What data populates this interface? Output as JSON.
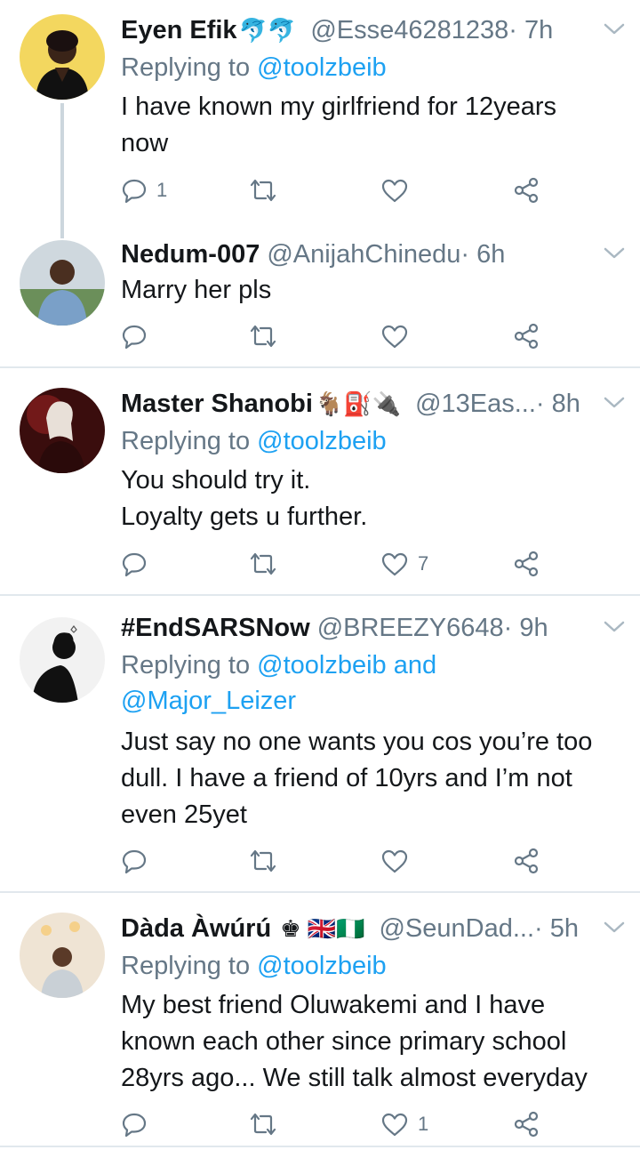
{
  "colors": {
    "link": "#1da1f2",
    "secondary_text": "#657786",
    "primary_text": "#14171a",
    "divider": "#e1e8ed",
    "thread_line": "#ccd6dd"
  },
  "tweets": [
    {
      "name": "Eyen Efik",
      "name_emoji": "🐬🐬",
      "handle": "@Esse46281238",
      "time": " · 7h",
      "replying_prefix": "Replying to ",
      "replying_to": "@toolzbeib",
      "text": "I have known my girlfriend for 12years\nnow",
      "reply_count": "1",
      "like_count": ""
    },
    {
      "name": "Nedum-007",
      "name_emoji": "",
      "handle": "@AnijahChinedu",
      "time": " · 6h",
      "text": "Marry her pls",
      "reply_count": "",
      "like_count": ""
    },
    {
      "name": "Master Shanobi",
      "name_emoji": "🐐⛽🔌",
      "handle": "@13Eas...",
      "time": " · 8h",
      "replying_prefix": "Replying to ",
      "replying_to": "@toolzbeib",
      "text": "You should try it.\nLoyalty gets u further.",
      "reply_count": "",
      "like_count": "7"
    },
    {
      "name": "#EndSARSNow",
      "name_emoji": "",
      "handle": "@BREEZY6648",
      "time": " · 9h",
      "replying_prefix": "Replying to ",
      "replying_to": "@toolzbeib and",
      "replying_to_2": "@Major_Leizer",
      "text": "Just say no one wants you cos you’re too\ndull. I have a friend of 10yrs and I’m not\neven 25yet",
      "reply_count": "",
      "like_count": ""
    },
    {
      "name": "Dàda Àwúrú",
      "name_emoji": "♚ 🇬🇧🇳🇬",
      "handle": "@SeunDad...",
      "time": " · 5h",
      "replying_prefix": "Replying to ",
      "replying_to": "@toolzbeib",
      "text": "My best friend Oluwakemi and I have\nknown each other since primary school\n28yrs ago... We still talk almost everyday",
      "reply_count": "",
      "like_count": "1"
    }
  ]
}
